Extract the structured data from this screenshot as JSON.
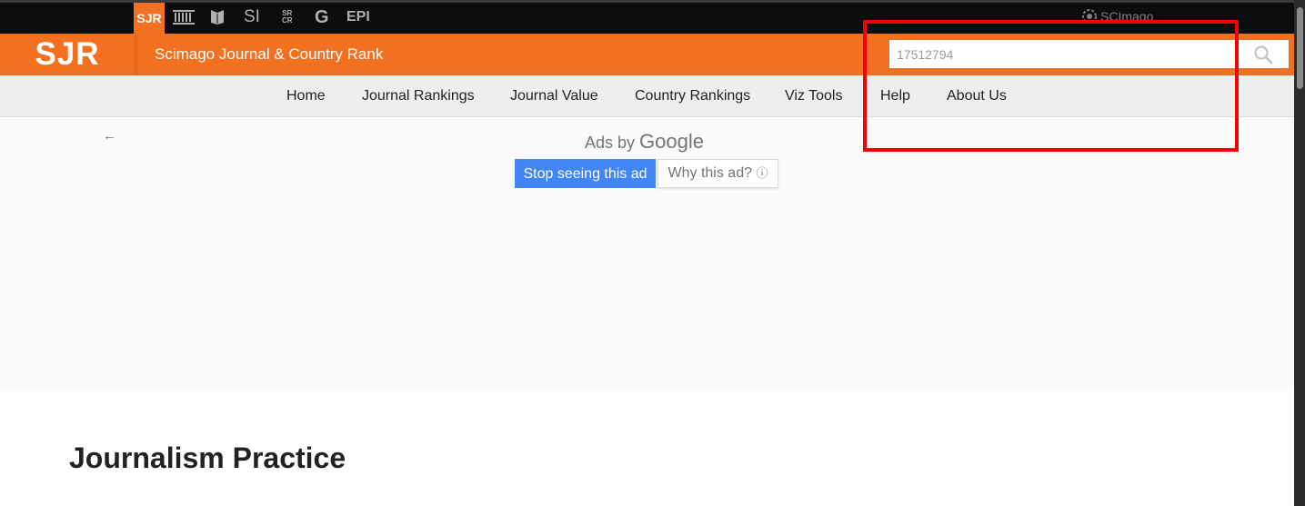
{
  "topbar": {
    "items": [
      {
        "label": "SJR",
        "icon": "sjr-icon",
        "active": true
      },
      {
        "icon": "institution-icon"
      },
      {
        "icon": "bookmark-shield-icon"
      },
      {
        "label": "SI",
        "icon": "si-icon"
      },
      {
        "label_top": "SR",
        "label_bottom": "CR",
        "icon": "srcr-icon"
      },
      {
        "label": "G",
        "icon": "google-g-icon"
      },
      {
        "label": "EPI",
        "icon": "epi-icon"
      }
    ],
    "brand": "SCImago"
  },
  "header": {
    "logo": "SJR",
    "title": "Scimago Journal & Country Rank",
    "search_value": "17512794",
    "accent_color": "#f37021"
  },
  "nav": {
    "items": [
      "Home",
      "Journal Rankings",
      "Journal Value",
      "Country Rankings",
      "Viz Tools",
      "Help",
      "About Us"
    ]
  },
  "ad": {
    "back_glyph": "←",
    "ads_by": "Ads by",
    "google": "Google",
    "stop_label": "Stop seeing this ad",
    "why_label": "Why this ad?",
    "info_glyph": "ⓘ"
  },
  "page": {
    "title": "Journalism Practice"
  },
  "annotation": {
    "color": "#f50000"
  }
}
